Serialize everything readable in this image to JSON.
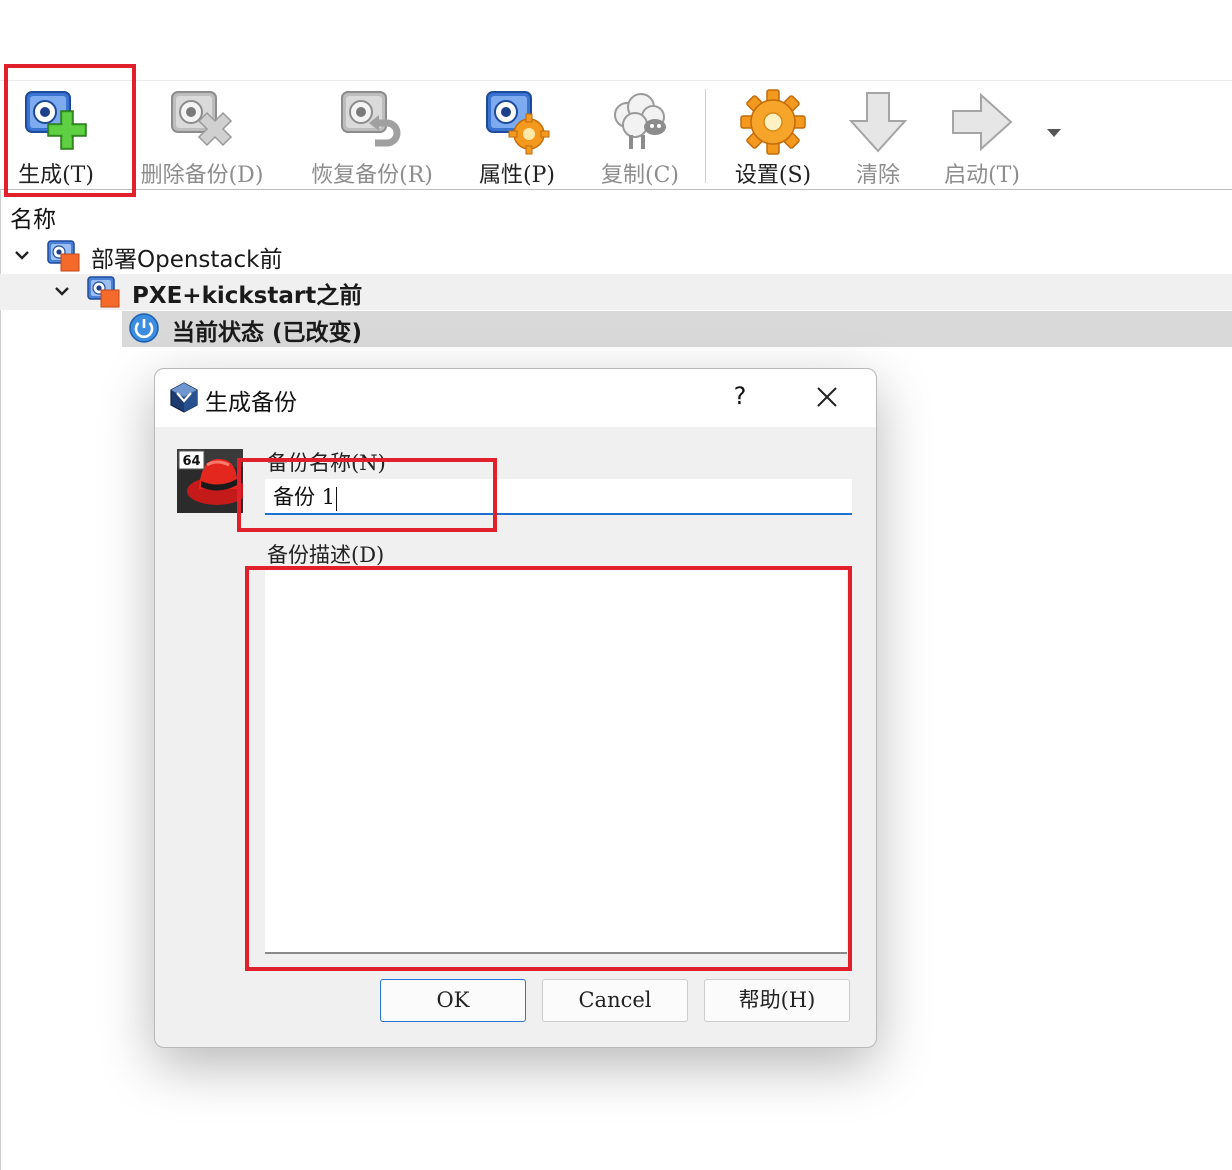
{
  "toolbar": {
    "buttons": [
      {
        "label": "生成(T)",
        "icon": "take-snapshot-icon",
        "enabled": true
      },
      {
        "label": "删除备份(D)",
        "icon": "delete-snapshot-icon",
        "enabled": false
      },
      {
        "label": "恢复备份(R)",
        "icon": "restore-snapshot-icon",
        "enabled": false
      },
      {
        "label": "属性(P)",
        "icon": "snapshot-properties-icon",
        "enabled": true
      },
      {
        "label": "复制(C)",
        "icon": "clone-sheep-icon",
        "enabled": false
      },
      {
        "label": "设置(S)",
        "icon": "settings-gear-icon",
        "enabled": true
      },
      {
        "label": "清除",
        "icon": "discard-arrow-down-icon",
        "enabled": false
      },
      {
        "label": "启动(T)",
        "icon": "start-arrow-right-icon",
        "enabled": false
      }
    ],
    "more_icon": "dropdown-triangle-icon"
  },
  "tree": {
    "column_header": "名称",
    "items": [
      {
        "label": "部署Openstack前",
        "level": 0,
        "expanded": true,
        "bold": false
      },
      {
        "label": "PXE+kickstart之前",
        "level": 1,
        "expanded": true,
        "bold": true
      },
      {
        "label": "当前状态 (已改变)",
        "level": 2,
        "bold": true,
        "selected": true
      }
    ]
  },
  "dialog": {
    "title": "生成备份",
    "help": "?",
    "os_badge": "64",
    "name_label": "备份名称(N)",
    "name_value": "备份 1",
    "desc_label": "备份描述(D)",
    "desc_value": "",
    "ok": "OK",
    "cancel": "Cancel",
    "help_button": "帮助(H)"
  },
  "colors": {
    "highlight_red": "#e0202a",
    "focus_blue": "#1f6fd1",
    "selection_gray": "#d9d9d9"
  }
}
